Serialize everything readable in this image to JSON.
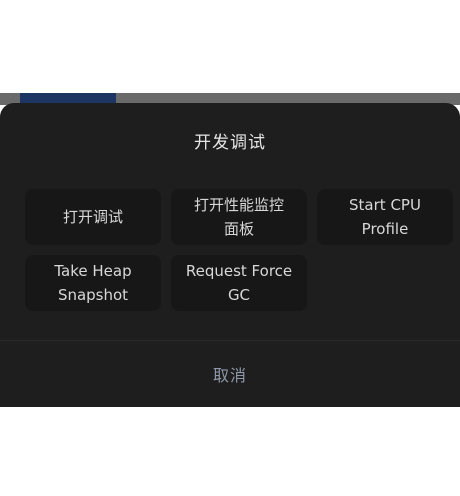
{
  "backdrop": {
    "tab_color": "#1d3562",
    "strip_color": "#6a6a6a"
  },
  "sheet": {
    "title": "开发调试",
    "background": "#1e1e1e",
    "actions": [
      {
        "label": "打开调试"
      },
      {
        "label": "打开性能监控\n面板"
      },
      {
        "label": "Start CPU\nProfile"
      },
      {
        "label": "Take Heap\nSnapshot"
      },
      {
        "label": "Request Force\nGC"
      }
    ],
    "cancel_label": "取消",
    "cancel_color": "#8e98ab"
  }
}
